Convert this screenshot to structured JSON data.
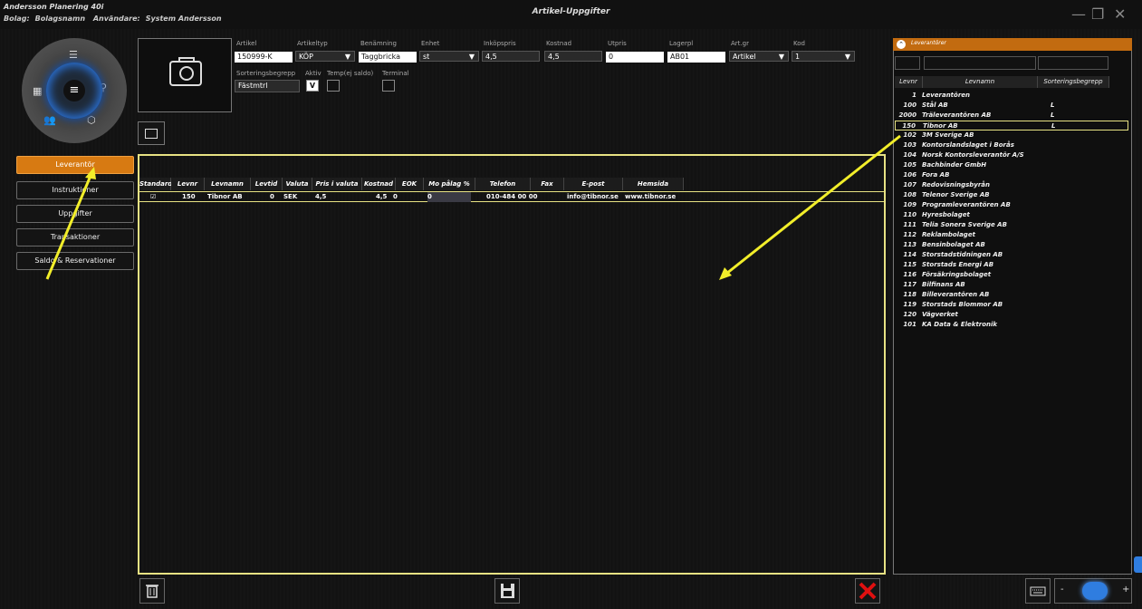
{
  "titlebar": {
    "app_name": "Andersson Planering 40i",
    "bolag_label": "Bolag:",
    "bolag_value": "Bolagsnamn",
    "user_label": "Användare:",
    "user_value": "System Andersson",
    "window_title": "Artikel-Uppgifter",
    "minimize": "—",
    "maximize": "❐",
    "close": "✕"
  },
  "nav": {
    "items": [
      {
        "label": "Leverantör",
        "active": true
      },
      {
        "label": "Instruktioner",
        "active": false
      },
      {
        "label": "Uppgifter",
        "active": false
      },
      {
        "label": "Transaktioner",
        "active": false
      },
      {
        "label": "Saldo & Reservationer",
        "active": false
      }
    ]
  },
  "form": {
    "labels": {
      "artikel": "Artikel",
      "artikeltyp": "Artikeltyp",
      "benamning": "Benämning",
      "enhet": "Enhet",
      "inkopspris": "Inköpspris",
      "kostnad": "Kostnad",
      "utpris": "Utpris",
      "lagerpl": "Lagerpl",
      "artgr": "Art.gr",
      "kod": "Kod",
      "sortering": "Sorteringsbegrepp",
      "aktiv": "Aktiv",
      "temp": "Temp(ej saldo)",
      "terminal": "Terminal"
    },
    "values": {
      "artikel": "150999-K",
      "artikeltyp": "KÖP",
      "benamning": "Taggbricka",
      "enhet": "st",
      "inkopspris": "4,5",
      "kostnad": "4,5",
      "utpris": "0",
      "lagerpl": "AB01",
      "artgr": "Artikel",
      "kod": "1",
      "sortering": "Fästmtrl",
      "aktiv": "V",
      "temp": "",
      "terminal": ""
    }
  },
  "grid": {
    "headers": [
      "Standard",
      "Levnr",
      "Levnamn",
      "Levtid",
      "Valuta",
      "Pris i valuta",
      "Kostnad",
      "EOK",
      "Mo pålag %",
      "Telefon",
      "Fax",
      "E-post",
      "Hemsida"
    ],
    "row": {
      "standard": "☑",
      "levnr": "150",
      "levnamn": "Tibnor AB",
      "levtid": "0",
      "valuta": "SEK",
      "pris": "4,5",
      "kostnad": "4,5",
      "eok": "0",
      "paslag": "0",
      "telefon": "010-484 00 00",
      "fax": "",
      "epost": "info@tibnor.se",
      "hemsida": "www.tibnor.se"
    }
  },
  "suppliers": {
    "title": "Leverantörer",
    "columns": [
      "Levnr",
      "Levnamn",
      "Sorteringsbegrepp"
    ],
    "rows": [
      {
        "nr": "1",
        "name": "Leverantören",
        "sort": ""
      },
      {
        "nr": "100",
        "name": "Stål AB",
        "sort": "L"
      },
      {
        "nr": "2000",
        "name": "Träleverantören AB",
        "sort": "L"
      },
      {
        "nr": "150",
        "name": "Tibnor AB",
        "sort": "L",
        "selected": true
      },
      {
        "nr": "102",
        "name": "3M Sverige AB",
        "sort": ""
      },
      {
        "nr": "103",
        "name": "Kontorslandslaget i Borås",
        "sort": ""
      },
      {
        "nr": "104",
        "name": "Norsk Kontorsleverantör A/S",
        "sort": ""
      },
      {
        "nr": "105",
        "name": "Bachbinder GmbH",
        "sort": ""
      },
      {
        "nr": "106",
        "name": "Fora AB",
        "sort": ""
      },
      {
        "nr": "107",
        "name": "Redovisningsbyrån",
        "sort": ""
      },
      {
        "nr": "108",
        "name": "Telenor Sverige AB",
        "sort": ""
      },
      {
        "nr": "109",
        "name": "Programleverantören AB",
        "sort": ""
      },
      {
        "nr": "110",
        "name": "Hyresbolaget",
        "sort": ""
      },
      {
        "nr": "111",
        "name": "Telia Sonera Sverige AB",
        "sort": ""
      },
      {
        "nr": "112",
        "name": "Reklambolaget",
        "sort": ""
      },
      {
        "nr": "113",
        "name": "Bensinbolaget AB",
        "sort": ""
      },
      {
        "nr": "114",
        "name": "Storstadstidningen AB",
        "sort": ""
      },
      {
        "nr": "115",
        "name": "Storstads Energi AB",
        "sort": ""
      },
      {
        "nr": "116",
        "name": "Försäkringsbolaget",
        "sort": ""
      },
      {
        "nr": "117",
        "name": "Bilfinans AB",
        "sort": ""
      },
      {
        "nr": "118",
        "name": "Billeverantören AB",
        "sort": ""
      },
      {
        "nr": "119",
        "name": "Storstads Blommor AB",
        "sort": ""
      },
      {
        "nr": "120",
        "name": "Vägverket",
        "sort": ""
      },
      {
        "nr": "101",
        "name": "KA Data & Elektronik",
        "sort": ""
      }
    ]
  },
  "toolbar": {
    "minus": "-",
    "plus": "+"
  },
  "colors": {
    "accent": "#d77a12",
    "highlight": "#e7e283",
    "arrow": "#f2ee2a",
    "delete": "#e01010"
  }
}
